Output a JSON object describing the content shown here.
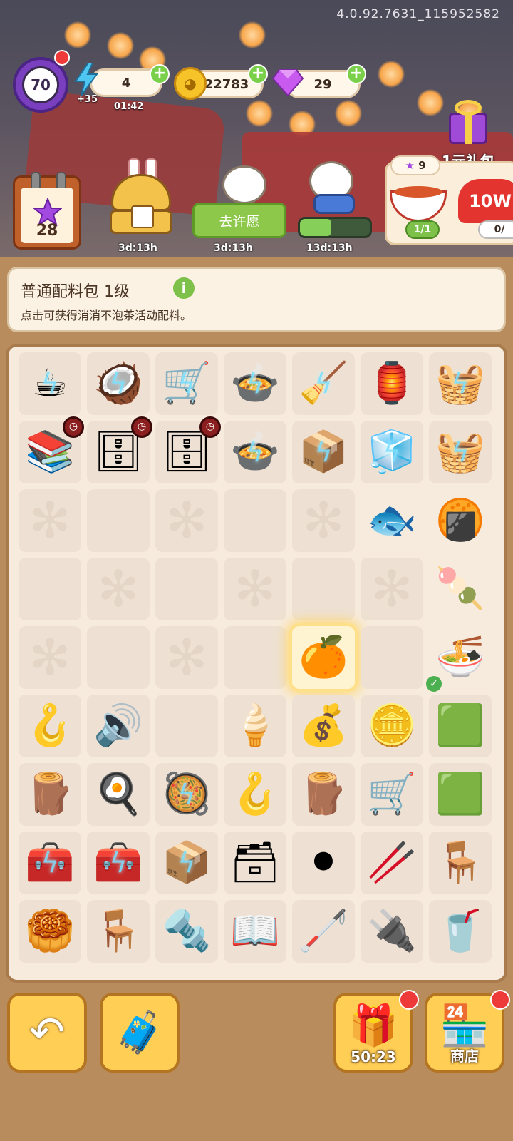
{
  "version": "4.0.92.7631_115952582",
  "hud": {
    "level": "70",
    "energy": "4",
    "energy_bonus": "+35",
    "energy_timer": "01:42",
    "coins": "22783",
    "gems": "29"
  },
  "events": {
    "calendar_count": "28",
    "event1_timer": "3d:13h",
    "event2_timer": "3d:13h",
    "wish_button": "去许愿",
    "event3_timer": "13d:13h",
    "event3_progress": 0.45,
    "gift_pack_label": "1元礼包",
    "gift_stars": "9",
    "gift_item1_count": "1/1",
    "gift_item2_label": "10W",
    "gift_item2_count": "0/"
  },
  "info_panel": {
    "title": "普通配料包  1级",
    "description": "点击可获得消消不泡茶活动配料。"
  },
  "bottom_bar": {
    "gift_timer": "50:23",
    "shop_label": "商店"
  },
  "colors": {
    "accent_green": "#7dc04a",
    "board_bg": "#f7ebdd",
    "frame_brown": "#a87a4c"
  }
}
